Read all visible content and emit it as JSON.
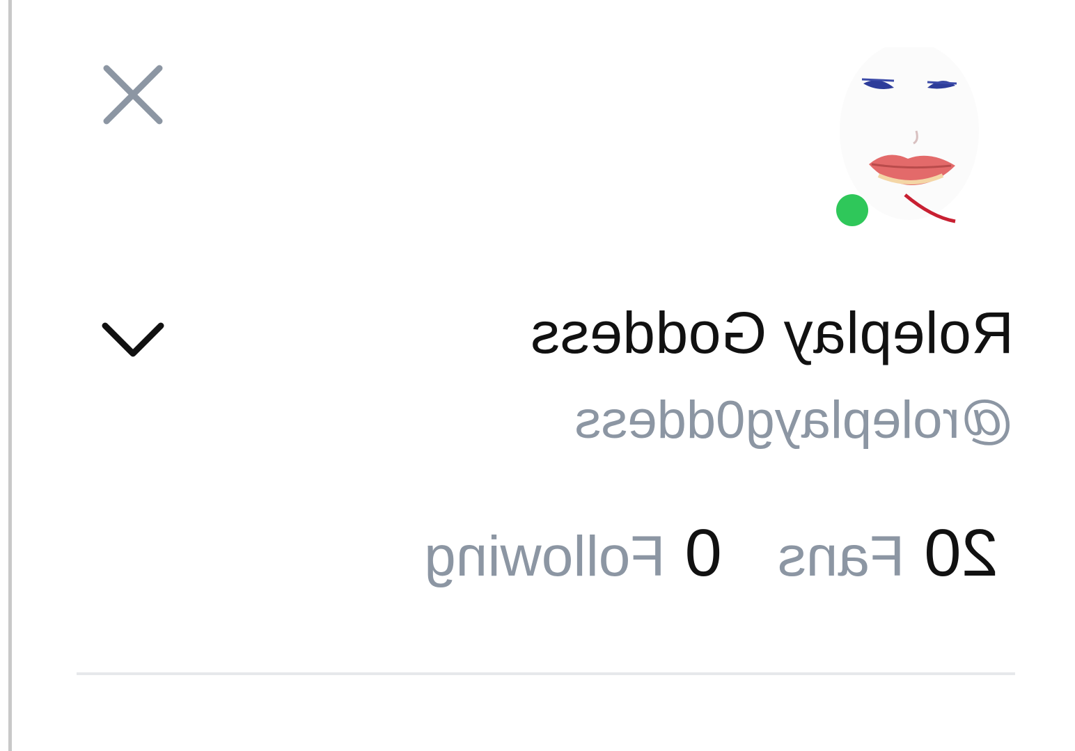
{
  "profile": {
    "display_name": "Roleplay Goddess",
    "username": "@roleplayg0ddess",
    "online": true,
    "online_color": "#2fc75a"
  },
  "stats": {
    "fans_count": "20",
    "fans_label": "Fans",
    "following_count": "0",
    "following_label": "Following"
  },
  "icons": {
    "close": "close-icon",
    "chevron": "chevron-down-icon",
    "avatar": "avatar-image"
  },
  "colors": {
    "text_primary": "#111111",
    "text_secondary": "#8c96a3",
    "icon_gray": "#8c96a3",
    "divider": "#e6e8eb"
  }
}
